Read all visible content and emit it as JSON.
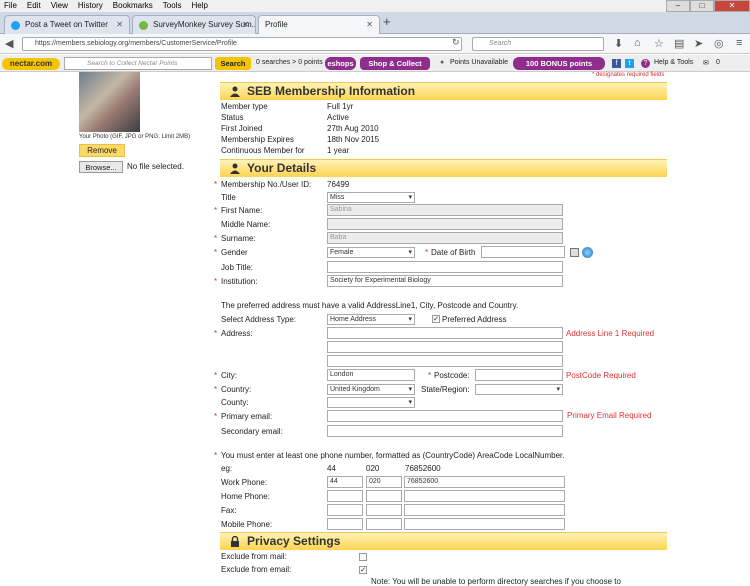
{
  "menu": [
    "File",
    "Edit",
    "View",
    "History",
    "Bookmarks",
    "Tools",
    "Help"
  ],
  "tabs": [
    {
      "label": "Post a Tweet on Twitter",
      "color": "#1da1f2"
    },
    {
      "label": "SurveyMonkey Survey Sum...",
      "color": "#79b743"
    },
    {
      "label": "Profile",
      "color": ""
    }
  ],
  "address_url": "https://members.sebiology.org/members/CustomerService/Profile",
  "search_placeholder": "Search",
  "nectar": {
    "logo": "nectar.com",
    "search_placeholder": "Search to Collect Nectar Points",
    "search_label": "Search",
    "points_text": "0 searches > 0 points",
    "eshops": "eshops",
    "shop_collect": "Shop & Collect",
    "points_status": "Points Unavailable",
    "bonus": "100 BONUS points",
    "help": "Help & Tools",
    "count": "0"
  },
  "required_note": "* designates required fields",
  "photo": {
    "caption": "Your Photo (GIF, JPG or PNG; Limit 2MB)",
    "remove": "Remove",
    "browse": "Browse...",
    "no_file": "No file selected."
  },
  "membership": {
    "title": "SEB Membership Information",
    "rows": [
      {
        "label": "Member type",
        "value": "Full 1yr"
      },
      {
        "label": "Status",
        "value": "Active"
      },
      {
        "label": "First Joined",
        "value": "27th Aug 2010"
      },
      {
        "label": "Membership Expires",
        "value": "18th Nov 2015"
      },
      {
        "label": "Continuous Member for",
        "value": "1 year"
      }
    ]
  },
  "details": {
    "title": "Your Details",
    "membership_no_label": "Membership No./User ID:",
    "membership_no": "76499",
    "title_label": "Title",
    "title_value": "Miss",
    "first_name_label": "First Name:",
    "first_name": "Sabina",
    "middle_name_label": "Middle Name:",
    "surname_label": "Surname:",
    "surname": "Baba",
    "gender_label": "Gender",
    "gender": "Female",
    "dob_label": "Date of Birth",
    "job_label": "Job Title:",
    "institution_label": "Institution:",
    "institution": "Society for Experimental Biology",
    "address_note": "The preferred address must have a valid AddressLine1, City, Postcode and Country.",
    "addr_type_label": "Select Address Type:",
    "addr_type": "Home Address",
    "preferred_label": "Preferred Address",
    "address_label": "Address:",
    "address_error": "Address Line 1 Required",
    "city_label": "City:",
    "city": "London",
    "postcode_label": "Postcode:",
    "postcode_error": "PostCode Required",
    "country_label": "Country:",
    "country": "United Kingdom",
    "state_label": "State/Region:",
    "county_label": "County:",
    "primary_email_label": "Primary email:",
    "primary_email_error": "Primary Email Required",
    "secondary_email_label": "Secondary email:",
    "phone_note": "You must enter at least one phone number, formatted as (CountryCode) AreaCode LocalNumber.",
    "eg_label": "eg:",
    "eg_cc": "44",
    "eg_area": "020",
    "eg_local": "76852600",
    "work_label": "Work Phone:",
    "work_cc": "44",
    "work_area": "020",
    "work_local": "76852600",
    "home_label": "Home Phone:",
    "fax_label": "Fax:",
    "mobile_label": "Mobile Phone:"
  },
  "privacy": {
    "title": "Privacy Settings",
    "exclude_mail": "Exclude from mail:",
    "exclude_email": "Exclude from email:",
    "note": "Note: You will be unable to perform directory searches if you choose to"
  }
}
